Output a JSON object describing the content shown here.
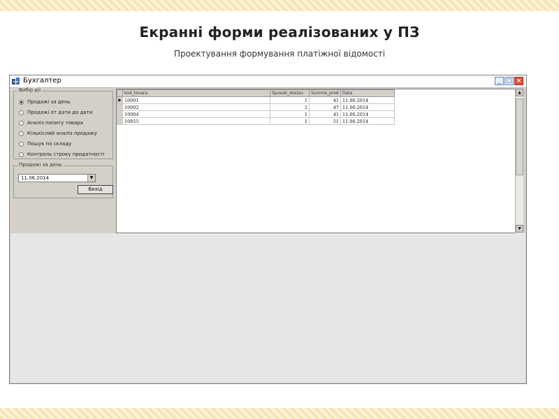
{
  "slide": {
    "title": "Екранні форми реалізованих у ПЗ",
    "subtitle": "Проектування формування платіжної відомості"
  },
  "window": {
    "title": "Бухгалтер",
    "min_glyph": "_",
    "max_glyph": "□",
    "close_glyph": "×"
  },
  "actions_group": {
    "legend": "Вибір дії",
    "options": [
      {
        "label": "Продажі за день",
        "selected": true
      },
      {
        "label": "Продажі от дати до дати",
        "selected": false
      },
      {
        "label": "Аналіз попиту товара",
        "selected": false
      },
      {
        "label": "Кількісний аналіз продажу",
        "selected": false
      },
      {
        "label": "Пошук по складу",
        "selected": false
      },
      {
        "label": "Контроль строку придатності",
        "selected": false
      }
    ]
  },
  "sales_group": {
    "legend": "Продажі за день",
    "date_value": "11.06.2014",
    "exit_label": "Вихід"
  },
  "grid": {
    "columns": [
      "kod_tovara",
      "Sposob_dostav",
      "Summa_prod",
      "Data"
    ],
    "rows": [
      {
        "indicator": "▶",
        "cells": [
          "10001",
          "1",
          "41",
          "11.06.2014"
        ]
      },
      {
        "indicator": "",
        "cells": [
          "10002",
          "2",
          "47",
          "11.06.2014"
        ]
      },
      {
        "indicator": "",
        "cells": [
          "10004",
          "1",
          "41",
          "11.06.2014"
        ]
      },
      {
        "indicator": "",
        "cells": [
          "10055",
          "1",
          "51",
          "11.06.2014"
        ]
      }
    ],
    "scroll_up_glyph": "▲",
    "scroll_down_glyph": "▼"
  },
  "icons": {
    "app": "app-icon",
    "combo_arrow": "chevron-down-icon"
  }
}
